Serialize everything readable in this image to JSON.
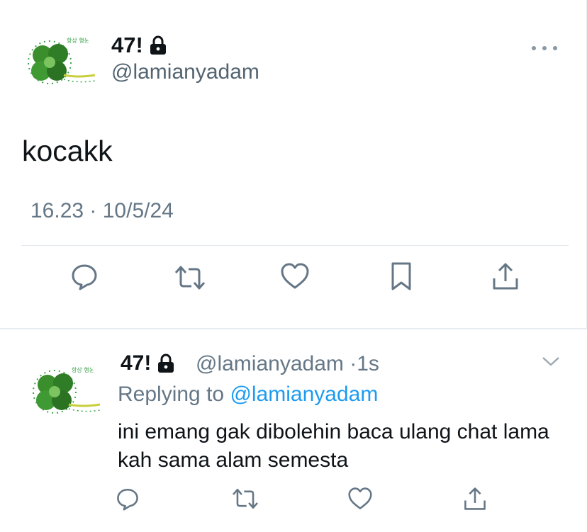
{
  "main_tweet": {
    "display_name": "47!",
    "handle": "@lamianyadam",
    "text": "kocakk",
    "timestamp": "16.23 · 10/5/24",
    "avatar_text": "항상 행운이 가득하시길"
  },
  "reply_tweet": {
    "display_name": "47!",
    "handle_time": "@lamianyadam ·1s",
    "replying_prefix": "Replying to",
    "replying_handle": "@lamianyadam",
    "text": "ini emang gak dibolehin baca ulang chat lama kah sama alam semesta",
    "avatar_text": "항상 행운이 가득하시길"
  },
  "icons": {
    "more": "more-dots-icon",
    "lock": "lock-icon",
    "reply": "reply-icon",
    "retweet": "retweet-icon",
    "like": "heart-icon",
    "bookmark": "bookmark-icon",
    "share": "share-icon",
    "chevron": "chevron-down-icon"
  },
  "colors": {
    "text": "#0f1419",
    "secondary": "#657786",
    "link": "#1d9bf0",
    "icon": "#657786"
  }
}
